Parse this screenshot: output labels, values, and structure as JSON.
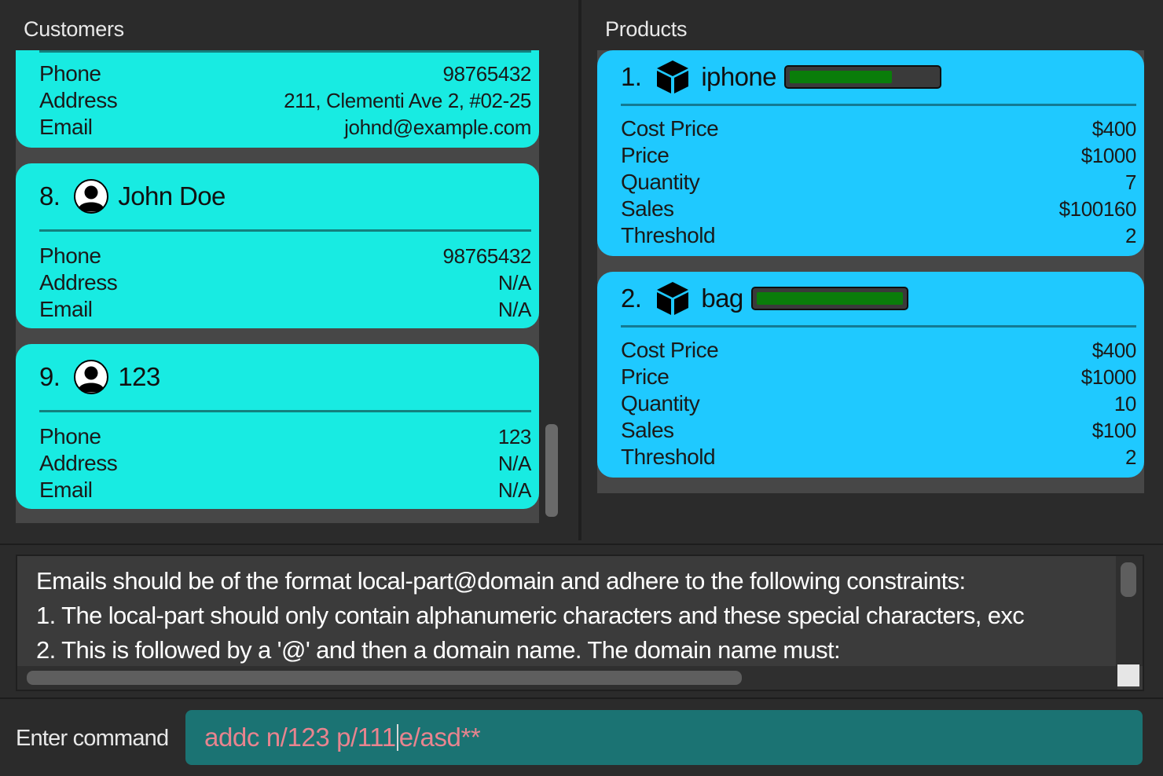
{
  "customers": {
    "title": "Customers",
    "partial_card": {
      "fields": [
        {
          "label": "Phone",
          "value": "98765432"
        },
        {
          "label": "Address",
          "value": "211, Clementi Ave 2, #02-25"
        },
        {
          "label": "Email",
          "value": "johnd@example.com"
        }
      ]
    },
    "cards": [
      {
        "index": "8.",
        "name": "John Doe",
        "icon": "person-avatar-icon",
        "fields": [
          {
            "label": "Phone",
            "value": "98765432"
          },
          {
            "label": "Address",
            "value": "N/A"
          },
          {
            "label": "Email",
            "value": "N/A"
          }
        ]
      },
      {
        "index": "9.",
        "name": "123",
        "icon": "person-avatar-icon",
        "fields": [
          {
            "label": "Phone",
            "value": "123"
          },
          {
            "label": "Address",
            "value": "N/A"
          },
          {
            "label": "Email",
            "value": "N/A"
          }
        ]
      }
    ]
  },
  "products": {
    "title": "Products",
    "cards": [
      {
        "index": "1.",
        "name": "iphone",
        "icon": "product-box-icon",
        "stock_level": 0.7,
        "fields": [
          {
            "label": "Cost Price",
            "value": "$400"
          },
          {
            "label": "Price",
            "value": "$1000"
          },
          {
            "label": "Quantity",
            "value": "7"
          },
          {
            "label": "Sales",
            "value": "$100160"
          },
          {
            "label": "Threshold",
            "value": "2"
          }
        ]
      },
      {
        "index": "2.",
        "name": "bag",
        "icon": "product-box-icon",
        "stock_level": 1.0,
        "fields": [
          {
            "label": "Cost Price",
            "value": "$400"
          },
          {
            "label": "Price",
            "value": "$1000"
          },
          {
            "label": "Quantity",
            "value": "10"
          },
          {
            "label": "Sales",
            "value": "$100"
          },
          {
            "label": "Threshold",
            "value": "2"
          }
        ]
      }
    ]
  },
  "result_display": {
    "lines": [
      "Emails should be of the format local-part@domain and adhere to the following constraints:",
      "1. The local-part should only contain alphanumeric characters and these special characters, exc",
      "2. This is followed by a '@' and then a domain name. The domain name must:"
    ]
  },
  "command_box": {
    "label": "Enter command",
    "text_before_caret": "addc n/123 p/111",
    "text_after_caret": "e/asd**"
  },
  "colors": {
    "background": "#2b2b2b",
    "customer_card": "#18ebe2",
    "product_card": "#1fc9ff",
    "stock_bar_fill": "#0a7d0a",
    "command_input_bg": "#1b7373",
    "command_input_error_text": "#e8848f"
  }
}
